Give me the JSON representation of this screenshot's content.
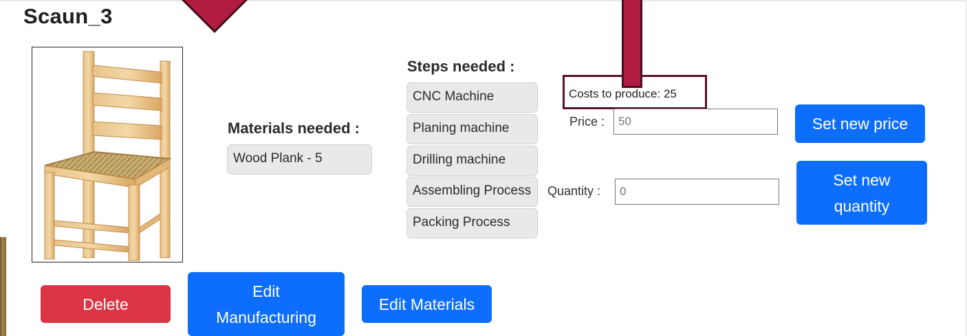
{
  "product": {
    "title": "Scaun_3"
  },
  "materials": {
    "heading": "Materials needed :",
    "items": [
      "Wood Plank - 5"
    ]
  },
  "steps": {
    "heading": "Steps needed :",
    "items": [
      "CNC Machine",
      "Planing machine",
      "Drilling machine",
      "Assembling Process",
      "Packing Process"
    ]
  },
  "costs": {
    "text": "Costs to produce: 25"
  },
  "price": {
    "label": "Price :",
    "value": "50"
  },
  "quantity": {
    "label": "Quantity :",
    "value": "0"
  },
  "buttons": {
    "set_price": "Set new price",
    "set_quantity": "Set new quantity",
    "delete": "Delete",
    "edit_manufacturing": "Edit Manufacturing",
    "edit_materials": "Edit Materials"
  },
  "colors": {
    "primary": "#0d6efd",
    "danger": "#dc3545",
    "annotation": "#b01c42"
  }
}
